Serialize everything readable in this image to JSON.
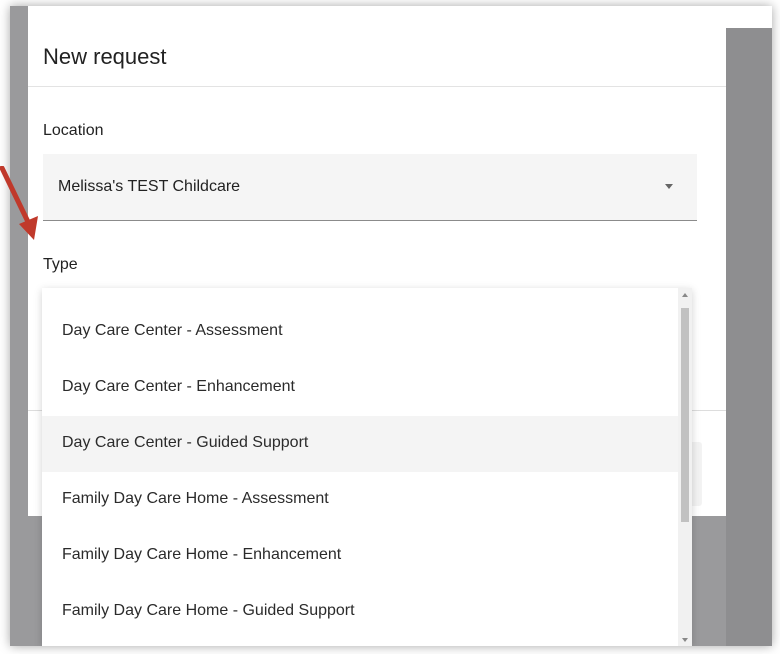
{
  "dialog": {
    "title": "New request",
    "location_label": "Location",
    "location_value": "Melissa's TEST Childcare",
    "type_label": "Type"
  },
  "dropdown": {
    "options": [
      "Day Care Center - Assessment",
      "Day Care Center - Enhancement",
      "Day Care Center - Guided Support",
      "Family Day Care Home - Assessment",
      "Family Day Care Home - Enhancement",
      "Family Day Care Home - Guided Support"
    ],
    "highlighted_index": 2
  },
  "annotation": {
    "arrow_color": "#c0392b"
  },
  "icons": [
    "chevron-down-icon",
    "scroll-up-arrow-icon",
    "scroll-down-arrow-icon",
    "annotation-arrow-icon"
  ]
}
